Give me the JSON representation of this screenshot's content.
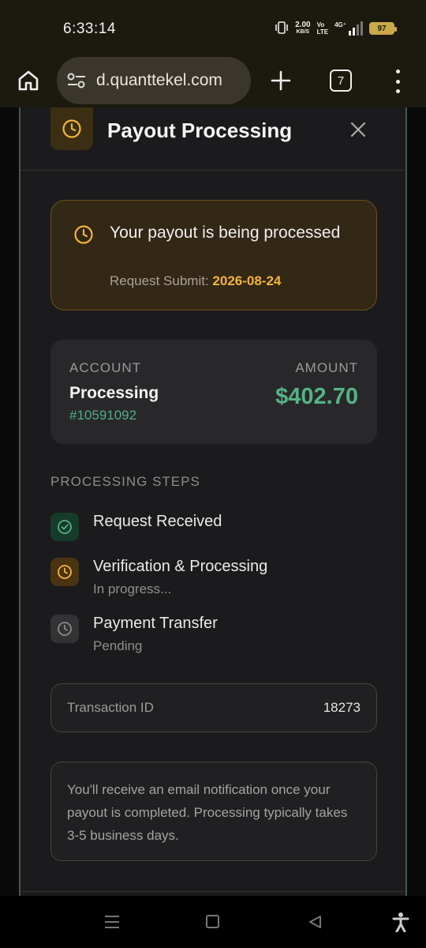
{
  "status_bar": {
    "time": "6:33:14",
    "net_speed": "2.00",
    "net_unit": "KB/S",
    "volte_top": "Vo",
    "volte_bottom": "LTE",
    "network": "4G⁺",
    "battery": "97"
  },
  "browser": {
    "url": "d.quanttekel.com",
    "tab_count": "7"
  },
  "modal": {
    "title": "Payout Processing",
    "notice": {
      "title": "Your payout is being processed",
      "sub_label": "Request Submit:",
      "date": "2026-08-24"
    },
    "account": {
      "account_label": "ACCOUNT",
      "amount_label": "AMOUNT",
      "status": "Processing",
      "id": "#10591092",
      "amount": "$402.70"
    },
    "steps_heading": "PROCESSING STEPS",
    "steps": [
      {
        "title": "Request Received",
        "sub": "",
        "state": "done"
      },
      {
        "title": "Verification & Processing",
        "sub": "In progress...",
        "state": "in-progress"
      },
      {
        "title": "Payment Transfer",
        "sub": "Pending",
        "state": "pending"
      }
    ],
    "transaction": {
      "label": "Transaction ID",
      "value": "18273"
    },
    "info": "You'll receive an email notification once your payout is completed. Processing typically takes 3-5 business days."
  },
  "colors": {
    "accent_amber": "#f3b53a",
    "accent_green": "#55b385",
    "modal_bg": "#1b1b1d",
    "notice_bg": "#332715"
  },
  "icons": {
    "status": [
      "vibrate-icon",
      "signal-icon",
      "battery-icon"
    ],
    "browser": [
      "home-icon",
      "site-settings-icon",
      "plus-icon",
      "tabs-icon",
      "more-vert-icon"
    ],
    "modal": [
      "clock-icon",
      "close-icon",
      "check-circle-icon"
    ],
    "nav": [
      "recents-icon",
      "home-nav-icon",
      "back-icon",
      "accessibility-icon"
    ]
  }
}
